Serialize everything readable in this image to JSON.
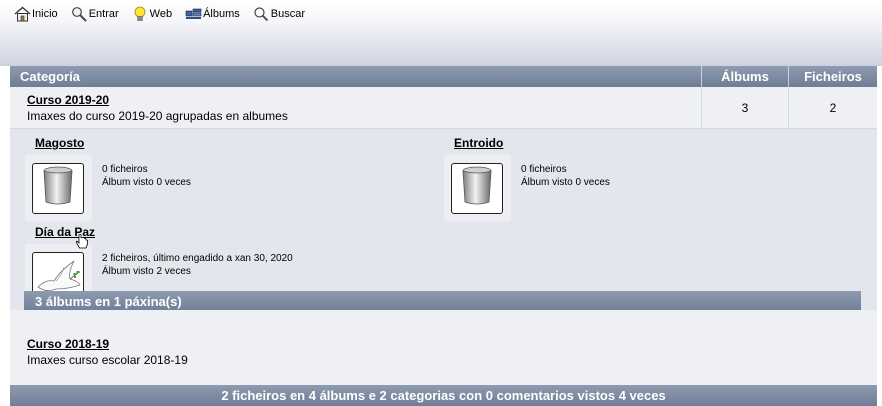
{
  "nav": {
    "items": [
      {
        "label": "Inicio",
        "icon": "home-icon"
      },
      {
        "label": "Entrar",
        "icon": "magnifier-key-icon"
      },
      {
        "label": "Web",
        "icon": "lightbulb-icon"
      },
      {
        "label": "Álbums",
        "icon": "albums-icon"
      },
      {
        "label": "Buscar",
        "icon": "search-icon"
      }
    ]
  },
  "table": {
    "headers": {
      "category": "Categoría",
      "albums": "Álbums",
      "files": "Ficheiros"
    },
    "categories": [
      {
        "title": "Curso 2019-20",
        "description": "Imaxes do curso 2019-20 agrupadas en albumes",
        "albums": "3",
        "files": "2"
      },
      {
        "title": "Curso 2018-19",
        "description": "Imaxes curso escolar 2018-19"
      }
    ]
  },
  "albums": [
    {
      "title": "Magosto",
      "line1": "0 ficheiros",
      "line2": "Álbum visto 0 veces",
      "thumb": "trash-can-icon"
    },
    {
      "title": "Entroido",
      "line1": "0 ficheiros",
      "line2": "Álbum visto 0 veces",
      "thumb": "trash-can-icon"
    },
    {
      "title": "Día da Paz",
      "line1": "2 ficheiros, último engadido a xan 30, 2020",
      "line2": "Álbum visto 2 veces",
      "thumb": "dove-icon"
    }
  ],
  "albums_footer": "3 álbums en 1 páxina(s)",
  "footer": "2 ficheiros en 4 álbums e 2 categorias con 0 comentarios vistos 4 veces",
  "colors": {
    "header_bar": "#7d8aa1",
    "row_bg": "#eef0f4",
    "album_bg": "#e3e6ec"
  }
}
